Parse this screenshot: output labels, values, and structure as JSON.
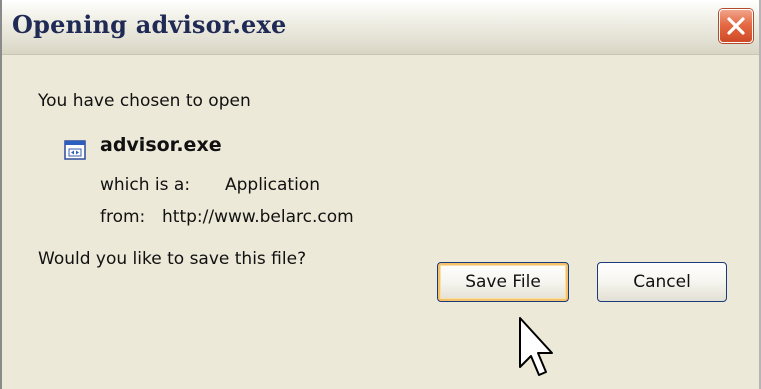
{
  "window": {
    "title": "Opening advisor.exe",
    "close_icon": "close-icon"
  },
  "dialog": {
    "intro": "You have chosen to open",
    "file": {
      "icon": "application-file-icon",
      "name": "advisor.exe",
      "type_label": "which is a:",
      "type_value": "Application",
      "from_label": "from:",
      "from_value": "http://www.belarc.com"
    },
    "question": "Would you like to save this file?"
  },
  "buttons": {
    "save_label": "Save File",
    "cancel_label": "Cancel"
  },
  "colors": {
    "dialog_background": "#ece9d8",
    "title_text": "#1f2a55",
    "close_button": "#e46a45",
    "default_button_highlight": "#f4c26b"
  }
}
